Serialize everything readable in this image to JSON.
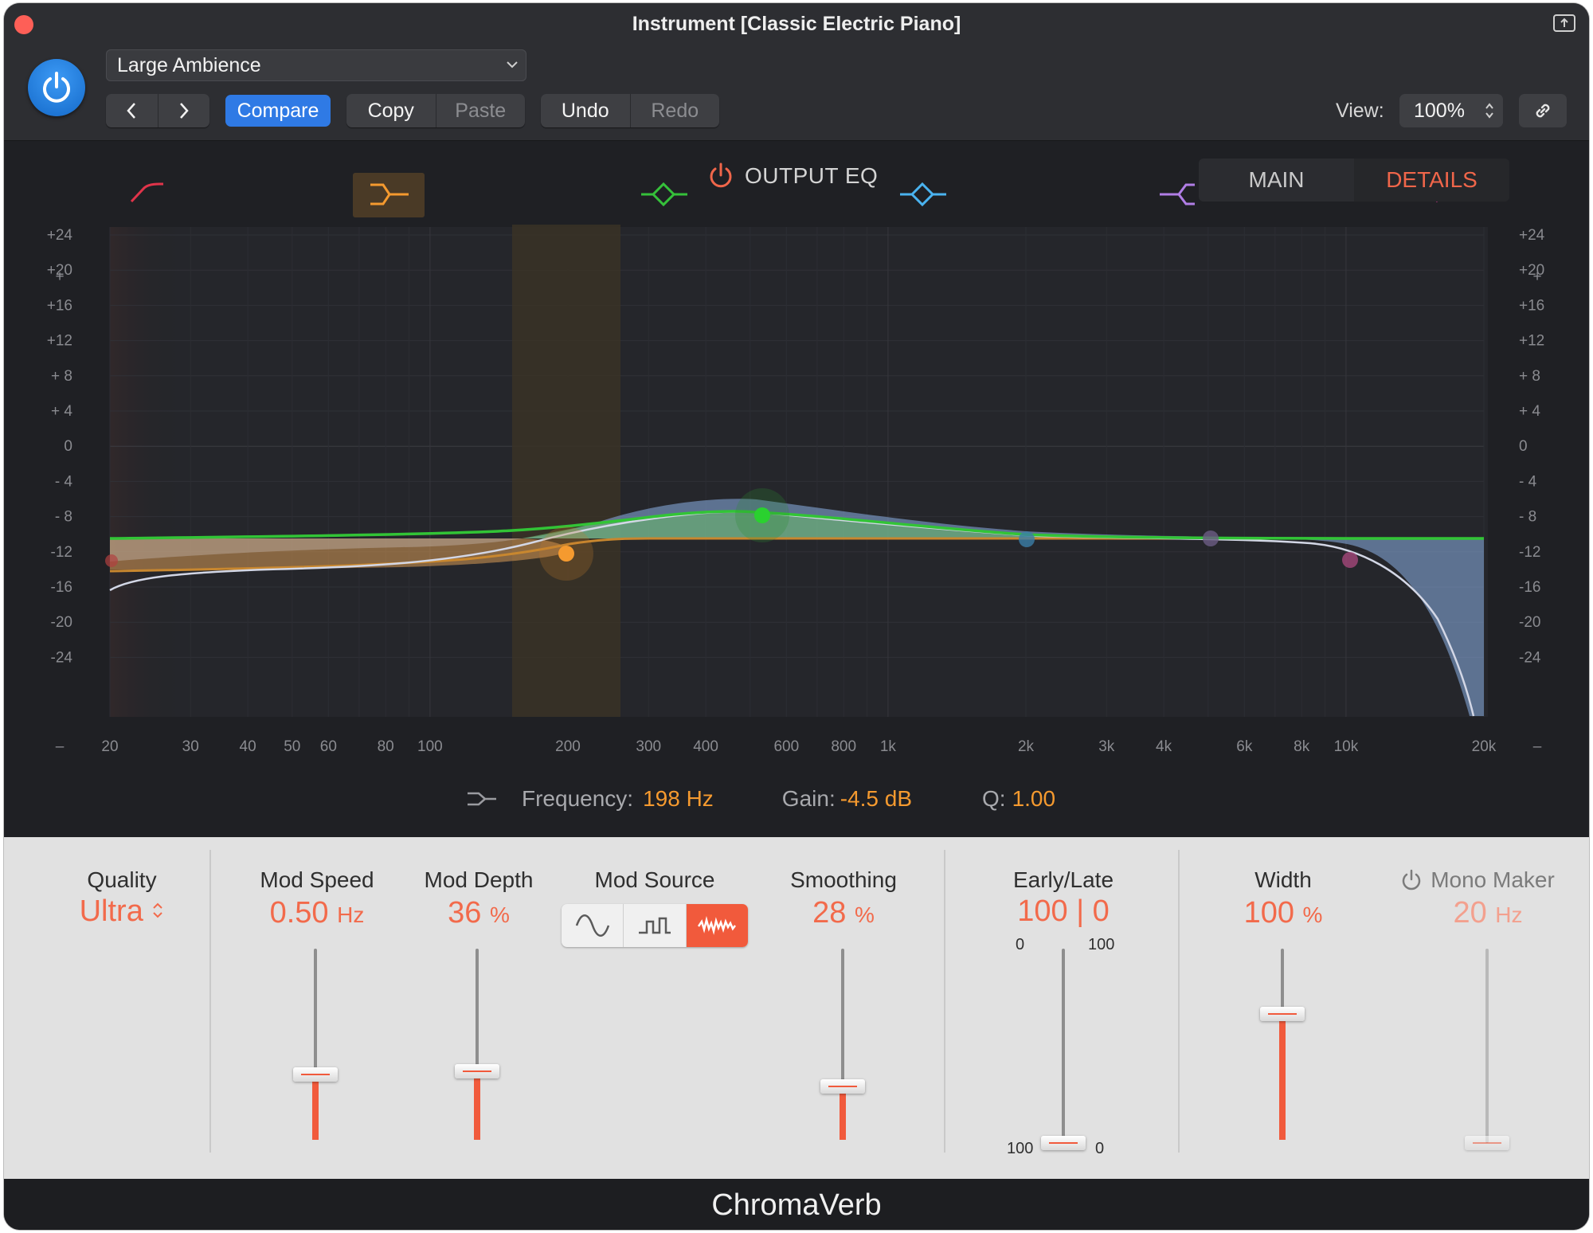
{
  "window": {
    "title": "Instrument [Classic Electric Piano]"
  },
  "header": {
    "preset": "Large Ambience",
    "nav_prev": "‹",
    "nav_next": "›",
    "compare": "Compare",
    "copy": "Copy",
    "paste": "Paste",
    "undo": "Undo",
    "redo": "Redo",
    "view_label": "View:",
    "view_value": "100%"
  },
  "eq": {
    "title": "OUTPUT EQ",
    "tabs": {
      "main": "MAIN",
      "details": "DETAILS"
    },
    "active_tab": "DETAILS",
    "db_labels": [
      "+24",
      "+20",
      "+16",
      "+12",
      "+ 8",
      "+ 4",
      "0",
      "- 4",
      "- 8",
      "-12",
      "-16",
      "-20",
      "-24"
    ],
    "freq_labels": [
      "20",
      "30",
      "40",
      "50",
      "60",
      "80",
      "100",
      "200",
      "300",
      "400",
      "600",
      "800",
      "1k",
      "2k",
      "3k",
      "4k",
      "6k",
      "8k",
      "10k",
      "20k"
    ],
    "band_icon_colors": [
      "#e0344a",
      "#f59a2f",
      "#35c13a",
      "#4ab3f0",
      "#b17ee6",
      "#e03a9a"
    ],
    "selected_band": 2,
    "params": {
      "frequency_label": "Frequency:",
      "frequency_value": "198 Hz",
      "gain_label": "Gain:",
      "gain_value": "-4.5 dB",
      "q_label": "Q:",
      "q_value": "1.00"
    }
  },
  "controls": {
    "quality": {
      "label": "Quality",
      "value": "Ultra"
    },
    "mod_speed": {
      "label": "Mod Speed",
      "value": "0.50",
      "unit": "Hz",
      "level": 0.34
    },
    "mod_depth": {
      "label": "Mod Depth",
      "value": "36",
      "unit": "%",
      "level": 0.36
    },
    "mod_source": {
      "label": "Mod Source",
      "options": [
        "sine-icon",
        "square-icon",
        "noise-icon"
      ],
      "selected": "noise-icon"
    },
    "smoothing": {
      "label": "Smoothing",
      "value": "28",
      "unit": "%",
      "level": 0.28
    },
    "early_late": {
      "label": "Early/Late",
      "value": "100 | 0",
      "left_top": "0",
      "right_top": "100",
      "left_bottom": "100",
      "right_bottom": "0",
      "level": 0.0
    },
    "width": {
      "label": "Width",
      "value": "100",
      "unit": "%",
      "level": 0.66
    },
    "mono_maker": {
      "label": "Mono Maker",
      "value": "20",
      "unit": "Hz",
      "level": 0.0
    }
  },
  "footer": {
    "plugin_name": "ChromaVerb"
  },
  "colors": {
    "accent": "#f15a3c",
    "compare_blue": "#2f7ae5",
    "gain_orange": "#f59a2f"
  }
}
